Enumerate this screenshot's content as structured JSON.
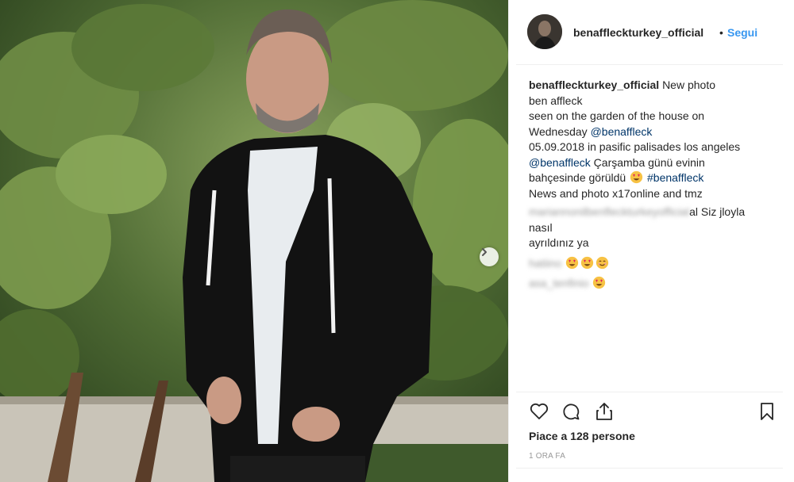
{
  "post": {
    "username": "benaffleckturkey_official",
    "separator": "•",
    "follow_label": "Segui",
    "caption_lines": [
      "New photo",
      "ben affleck",
      "seen on the garden of the house on",
      "Wednesday",
      "05.09.2018 in pasific palisades los angeles",
      "Çarşamba günü evinin",
      "bahçesinde görüldü",
      "News and photo x17online and tmz"
    ],
    "mentions": {
      "benaffleck_1": "@benaffleck",
      "benaffleck_2": "@benaffleck",
      "hashtag": "#benaffleck"
    },
    "likes_text": "Piace a 128 persone",
    "time_text": "1 ORA FA"
  },
  "comments": [
    {
      "user": "mariannonilbenfleckturkeyofficial",
      "text_a": "al Siz jloyla nasıl",
      "text_b": "ayrıldınız ya"
    },
    {
      "user": "hatiino",
      "emojis": [
        "heart-eyes-emoji",
        "heart-eyes-emoji",
        "smiling-emoji"
      ]
    },
    {
      "user": "asa_tenfinio",
      "emojis": [
        "heart-eyes-emoji"
      ]
    }
  ],
  "icons": {
    "like": "heart-outline-icon",
    "comment": "speech-bubble-icon",
    "share": "share-upload-icon",
    "save": "bookmark-icon",
    "carousel": "chevron-right-icon"
  },
  "colors": {
    "link_blue": "#3897f0",
    "mention": "#003569",
    "text": "#262626",
    "muted": "#999999",
    "divider": "#efefef"
  }
}
